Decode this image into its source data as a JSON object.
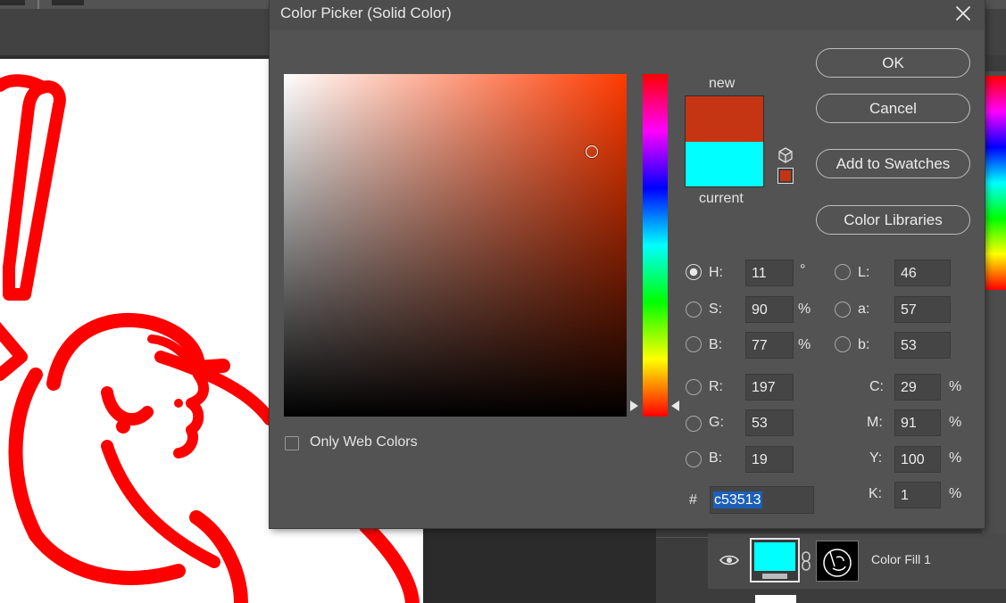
{
  "dialog": {
    "title": "Color Picker (Solid Color)",
    "close_icon": "close-icon"
  },
  "swatch": {
    "new_label": "new",
    "current_label": "current",
    "new_color": "#c53513",
    "current_color": "#00ffff"
  },
  "buttons": {
    "ok": "OK",
    "cancel": "Cancel",
    "add_to_swatches": "Add to Swatches",
    "color_libraries": "Color Libraries"
  },
  "only_web_colors": {
    "label": "Only Web Colors",
    "checked": false
  },
  "hsb": {
    "h_label": "H:",
    "h_value": "11",
    "h_unit": "°",
    "s_label": "S:",
    "s_value": "90",
    "s_unit": "%",
    "b_label": "B:",
    "b_value": "77",
    "b_unit": "%",
    "selected": "H"
  },
  "lab": {
    "l_label": "L:",
    "l_value": "46",
    "a_label": "a:",
    "a_value": "57",
    "b_label": "b:",
    "b_value": "53"
  },
  "rgb": {
    "r_label": "R:",
    "r_value": "197",
    "g_label": "G:",
    "g_value": "53",
    "b_label": "B:",
    "b_value": "19"
  },
  "cmyk": {
    "c_label": "C:",
    "c_value": "29",
    "m_label": "M:",
    "m_value": "91",
    "y_label": "Y:",
    "y_value": "100",
    "k_label": "K:",
    "k_value": "1",
    "unit": "%"
  },
  "hex": {
    "label": "#",
    "value": "c53513"
  },
  "layers": {
    "layer_name": "Color Fill 1",
    "fill_color": "#00ffff"
  },
  "colors": {
    "artwork_red": "#ff0000",
    "dialog_bg": "#535353",
    "selection_blue": "#1c5fb8"
  }
}
